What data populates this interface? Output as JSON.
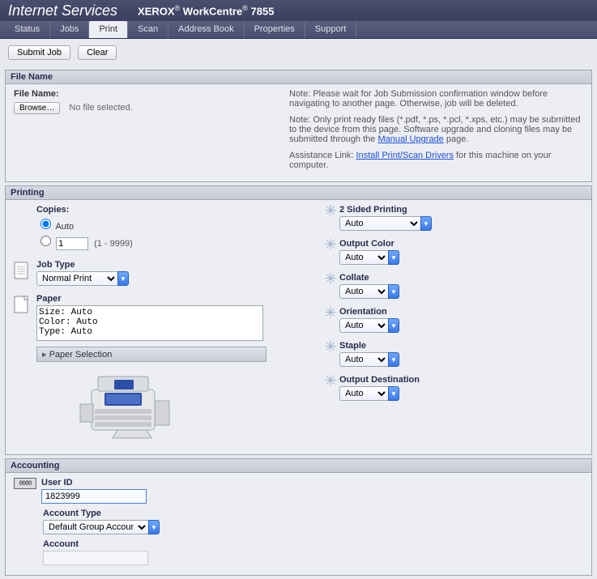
{
  "banner": {
    "brand": "Internet Services",
    "model_prefix": "XEROX",
    "model_mid": "WorkCentre",
    "model_num": "7855"
  },
  "nav": {
    "tabs": [
      "Status",
      "Jobs",
      "Print",
      "Scan",
      "Address Book",
      "Properties",
      "Support"
    ],
    "active": "Print"
  },
  "toolbar": {
    "submit": "Submit Job",
    "clear": "Clear"
  },
  "filename": {
    "panel_title": "File Name",
    "label": "File Name:",
    "browse": "Browse…",
    "nofile": "No file selected.",
    "note1": "Note: Please wait for Job Submission confirmation window before navigating to another page. Otherwise, job will be deleted.",
    "note2a": "Note: Only print ready files (*.pdf, *.ps, *.pcl, *.xps, etc.) may be submitted to the device from this page. Software upgrade and cloning files may be submitted through the ",
    "note2_link": "Manual Upgrade",
    "note2b": " page.",
    "assist_label": "Assistance Link: ",
    "assist_link": "Install Print/Scan Drivers",
    "assist_tail": " for this machine on your computer."
  },
  "printing": {
    "panel_title": "Printing",
    "copies": {
      "label": "Copies:",
      "auto": "Auto",
      "number_value": "1",
      "range": "(1 - 9999)"
    },
    "job_type": {
      "label": "Job Type",
      "value": "Normal Print"
    },
    "paper": {
      "label": "Paper",
      "text": "Size: Auto\nColor: Auto\nType: Auto",
      "selection": "Paper Selection"
    },
    "right": {
      "two_sided": {
        "label": "2 Sided Printing",
        "value": "Auto"
      },
      "output_color": {
        "label": "Output Color",
        "value": "Auto"
      },
      "collate": {
        "label": "Collate",
        "value": "Auto"
      },
      "orientation": {
        "label": "Orientation",
        "value": "Auto"
      },
      "staple": {
        "label": "Staple",
        "value": "Auto"
      },
      "output_dest": {
        "label": "Output Destination",
        "value": "Auto"
      }
    }
  },
  "accounting": {
    "panel_title": "Accounting",
    "icon_digits": "0000",
    "user_id_label": "User ID",
    "user_id_value": "1823999",
    "account_type_label": "Account Type",
    "account_type_value": "Default Group Account",
    "account_label": "Account",
    "account_value": ""
  }
}
